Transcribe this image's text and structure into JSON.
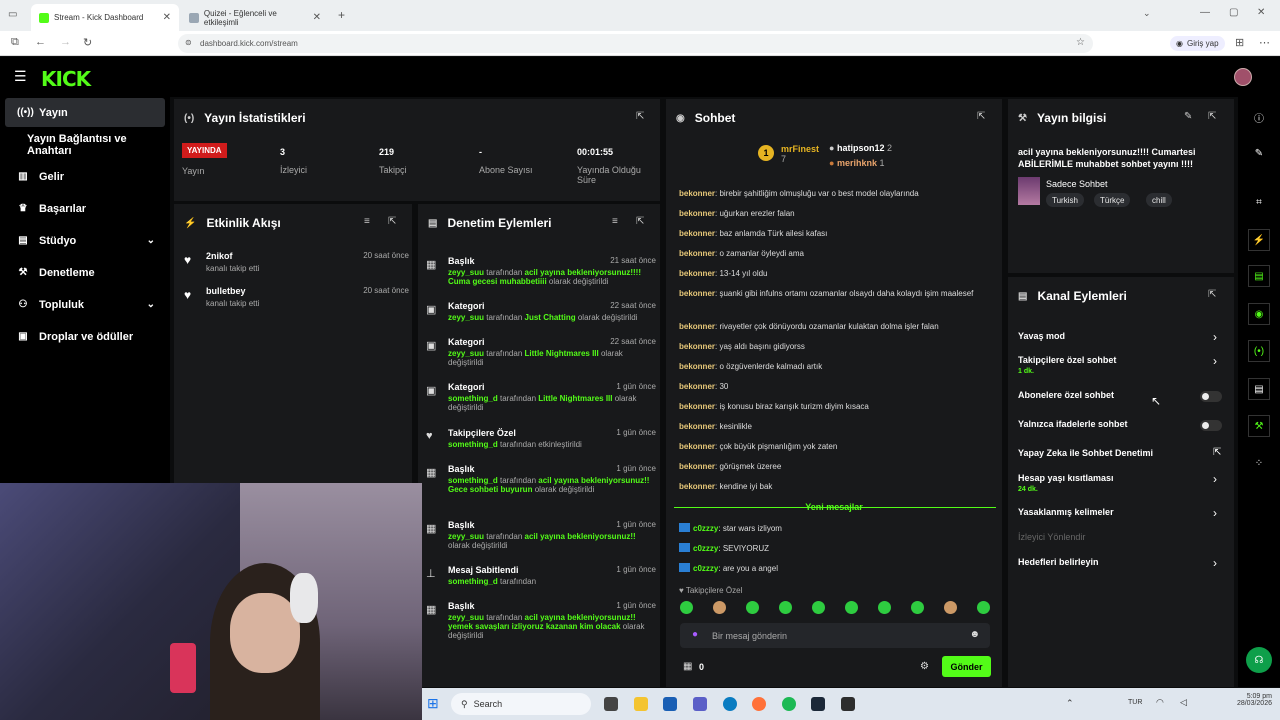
{
  "browser": {
    "tabs": [
      {
        "title": "Stream - Kick Dashboard"
      },
      {
        "title": "Quizei - Eğlenceli ve etkileşimli"
      }
    ],
    "url": "dashboard.kick.com/stream",
    "signin": "Giriş yap"
  },
  "kick": {
    "logo": "KICK"
  },
  "sidebar": {
    "items": [
      {
        "label": "Yayın",
        "icon": "broadcast-icon"
      },
      {
        "label": "Yayın Bağlantısı ve Anahtarı"
      },
      {
        "label": "Gelir",
        "icon": "chart-icon"
      },
      {
        "label": "Başarılar",
        "icon": "trophy-icon"
      },
      {
        "label": "Stüdyo",
        "icon": "studio-icon"
      },
      {
        "label": "Denetleme",
        "icon": "wrench-icon"
      },
      {
        "label": "Topluluk",
        "icon": "users-icon"
      },
      {
        "label": "Droplar ve ödüller",
        "icon": "gift-icon"
      }
    ]
  },
  "stats": {
    "title": "Yayın İstatistikleri",
    "live_badge": "YAYINDA",
    "live_label": "Yayın",
    "viewers": "3",
    "viewers_label": "İzleyici",
    "followers": "219",
    "followers_label": "Takipçi",
    "subs": "-",
    "subs_label": "Abone Sayısı",
    "duration": "00:01:55",
    "duration_label": "Yayında Olduğu Süre"
  },
  "activity": {
    "title": "Etkinlik Akışı",
    "items": [
      {
        "name": "2nikof",
        "sub": "kanalı takip etti",
        "time": "20 saat önce"
      },
      {
        "name": "bulletbey",
        "sub": "kanalı takip etti",
        "time": "20 saat önce"
      }
    ]
  },
  "moderation": {
    "title": "Denetim Eylemleri",
    "items": [
      {
        "head": "Başlık",
        "time": "21 saat önce",
        "user": "zeyy_suu",
        "mid": " tarafından ",
        "val": "acil yayına bekleniyorsunuz!!!! Cuma gecesi muhabbetiiii",
        "end": " olarak değiştirildi"
      },
      {
        "head": "Kategori",
        "time": "22 saat önce",
        "user": "zeyy_suu",
        "mid": " tarafından ",
        "val": "Just Chatting",
        "end": " olarak değiştirildi"
      },
      {
        "head": "Kategori",
        "time": "22 saat önce",
        "user": "zeyy_suu",
        "mid": " tarafından ",
        "val": "Little Nightmares III",
        "end": " olarak değiştirildi"
      },
      {
        "head": "Kategori",
        "time": "1 gün önce",
        "user": "something_d",
        "mid": " tarafından ",
        "val": "Little Nightmares III",
        "end": " olarak değiştirildi"
      },
      {
        "head": "Takipçilere Özel",
        "time": "1 gün önce",
        "user": "something_d",
        "mid": " tarafından etkinleştirildi",
        "val": "",
        "end": ""
      },
      {
        "head": "Başlık",
        "time": "1 gün önce",
        "user": "something_d",
        "mid": " tarafından ",
        "val": "acil yayına bekleniyorsunuz!! Gece sohbeti buyurun",
        "end": " olarak değiştirildi"
      },
      {
        "head": "Başlık",
        "time": "1 gün önce",
        "user": "zeyy_suu",
        "mid": " tarafından ",
        "val": "acil yayına bekleniyorsunuz!!",
        "end": " olarak değiştirildi"
      },
      {
        "head": "Mesaj Sabitlendi",
        "time": "1 gün önce",
        "user": "something_d",
        "mid": " tarafından",
        "val": "",
        "end": ""
      },
      {
        "head": "Başlık",
        "time": "1 gün önce",
        "user": "zeyy_suu",
        "mid": " tarafından ",
        "val": "acil yayına bekleniyorsunuz!! yemek savaşları izliyoruz kazanan kim olacak",
        "end": " olarak değiştirildi"
      }
    ]
  },
  "chat": {
    "title": "Sohbet",
    "top": {
      "u1": "mrFinest",
      "c1": "7",
      "u2": "hatipson12",
      "c2": "2",
      "u3": "merihknk",
      "c3": "1",
      "rank": "1"
    },
    "messages": [
      {
        "user": "bekonner",
        "text": "birebir şahitliğim olmuşluğu var o best model olaylarında"
      },
      {
        "user": "bekonner",
        "text": "uğurkan erezler falan"
      },
      {
        "user": "bekonner",
        "text": "baz anlamda Türk ailesi kafası"
      },
      {
        "user": "bekonner",
        "text": "o zamanlar öyleydi ama"
      },
      {
        "user": "bekonner",
        "text": "13-14 yıl oldu"
      },
      {
        "user": "bekonner",
        "text": "şuanki gibi infulns ortamı ozamanlar olsaydı daha kolaydı işim maalesef"
      },
      {
        "user": "bekonner",
        "text": "rivayetler çok dönüyordu ozamanlar kulaktan dolma işler falan"
      },
      {
        "user": "bekonner",
        "text": "yaş aldı başını gidiyorss"
      },
      {
        "user": "bekonner",
        "text": "o özgüvenlerde kalmadı artık"
      },
      {
        "user": "bekonner",
        "text": "30"
      },
      {
        "user": "bekonner",
        "text": "iş konusu biraz karışık turizm diyim kısaca"
      },
      {
        "user": "bekonner",
        "text": "kesinlikle"
      },
      {
        "user": "bekonner",
        "text": "çok büyük pişmanlığım yok zaten"
      },
      {
        "user": "bekonner",
        "text": "görüşmek üzeree"
      },
      {
        "user": "bekonner",
        "text": "kendine iyi bak"
      }
    ],
    "new_label": "Yeni mesajlar",
    "new_messages": [
      {
        "user": "c0zzzy",
        "text": "star wars izliyom"
      },
      {
        "user": "c0zzzy",
        "text": "SEVIYORUZ"
      },
      {
        "user": "c0zzzy",
        "text": "are you a angel"
      }
    ],
    "followers_only": "Takipçilere Özel",
    "placeholder": "Bir mesaj gönderin",
    "points": "0",
    "send": "Gönder"
  },
  "info": {
    "title": "Yayın bilgisi",
    "stream_title": "acil yayına bekleniyorsunuz!!!! Cumartesi ABİLERİMLE muhabbet sohbet yayını !!!!",
    "category": "Sadece Sohbet",
    "tags": [
      "Turkish",
      "Türkçe",
      "chill"
    ]
  },
  "channel": {
    "title": "Kanal Eylemleri",
    "items": [
      {
        "label": "Yavaş mod",
        "kind": "arrow"
      },
      {
        "label": "Takipçilere özel sohbet",
        "sub": "1 dk.",
        "kind": "arrow"
      },
      {
        "label": "Abonelere özel sohbet",
        "kind": "toggle"
      },
      {
        "label": "Yalnızca ifadelerle sohbet",
        "kind": "toggle"
      },
      {
        "label": "Yapay Zeka ile Sohbet Denetimi",
        "kind": "link"
      },
      {
        "label": "Hesap yaşı kısıtlaması",
        "sub": "24 dk.",
        "kind": "arrow"
      },
      {
        "label": "Yasaklanmış kelimeler",
        "kind": "arrow"
      },
      {
        "label": "İzleyici Yönlendir",
        "kind": "disabled"
      },
      {
        "label": "Hedefleri belirleyin",
        "kind": "arrow"
      }
    ]
  },
  "taskbar": {
    "search": "Search",
    "lang": "TUR",
    "time": "5:09 pm",
    "date": "28/03/2026"
  },
  "colors": {
    "accent": "#53fc18",
    "live": "#d11c1c",
    "panel": "#18191b"
  }
}
